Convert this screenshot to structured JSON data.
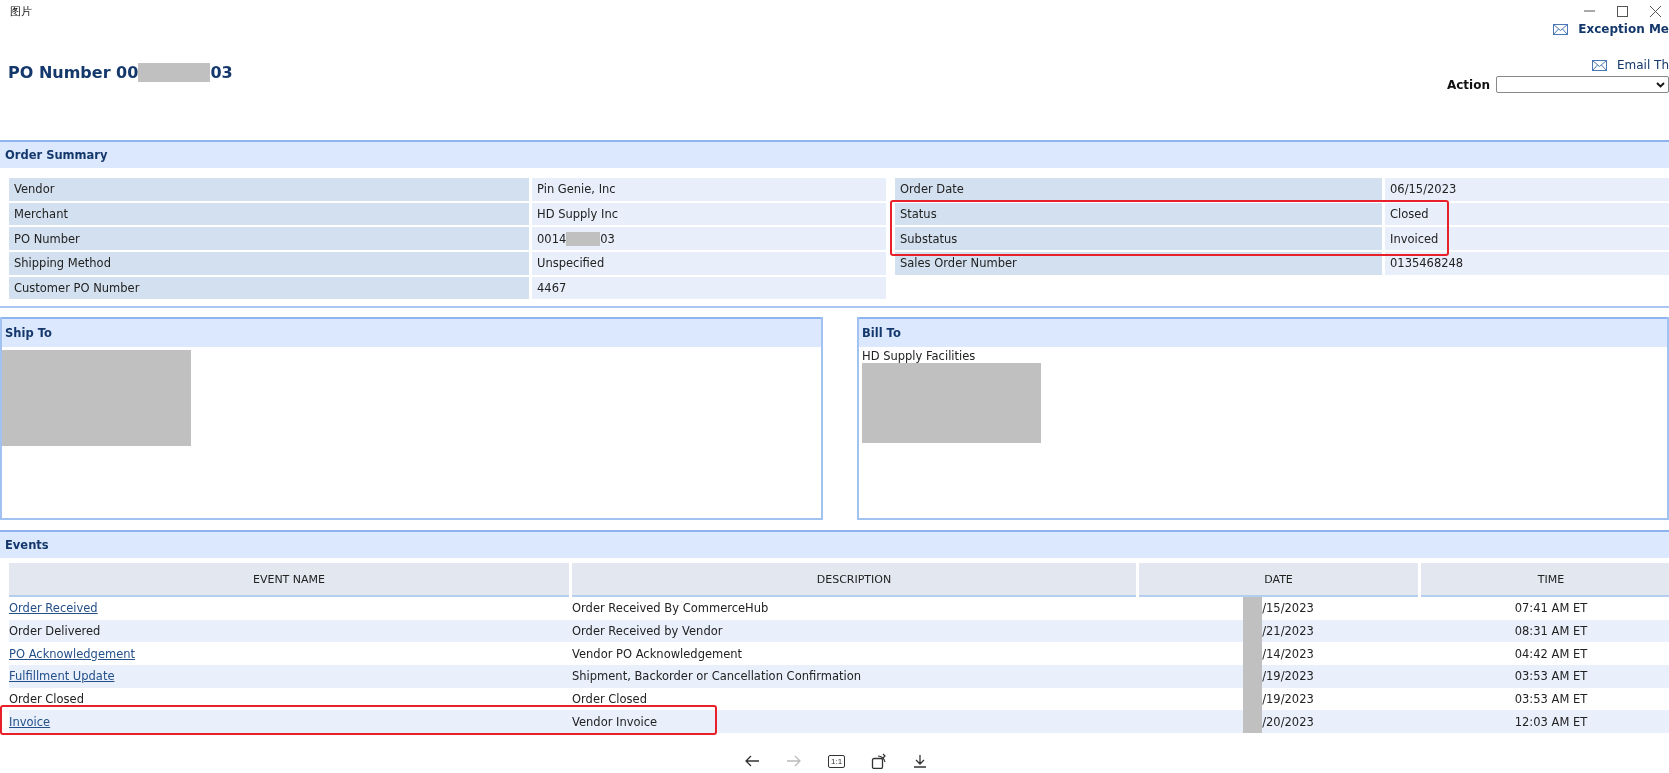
{
  "window": {
    "title": "图片"
  },
  "header": {
    "heading_prefix": "PO Number 00",
    "heading_suffix": "03",
    "links": [
      "Exception Me",
      "Email Th"
    ],
    "action_label": "Action"
  },
  "order_summary": {
    "title": "Order Summary",
    "left": [
      {
        "label": "Vendor",
        "value": "Pin Genie, Inc"
      },
      {
        "label": "Merchant",
        "value": "HD Supply Inc"
      },
      {
        "label": "PO Number",
        "value_prefix": "0014",
        "value_suffix": "03"
      },
      {
        "label": "Shipping Method",
        "value": "Unspecified"
      },
      {
        "label": "Customer PO Number",
        "value": "4467"
      }
    ],
    "right": [
      {
        "label": "Order Date",
        "value": "06/15/2023",
        "highlighted": false
      },
      {
        "label": "Status",
        "value": "Closed",
        "highlighted": true
      },
      {
        "label": "Substatus",
        "value": "Invoiced",
        "highlighted": true
      },
      {
        "label": "Sales Order Number",
        "value": "0135468248",
        "highlighted": false
      }
    ]
  },
  "ship_to": {
    "title": "Ship To"
  },
  "bill_to": {
    "title": "Bill To",
    "line": "HD Supply Facilities"
  },
  "events": {
    "title": "Events",
    "columns": [
      "EVENT NAME",
      "DESCRIPTION",
      "DATE",
      "TIME"
    ],
    "rows": [
      {
        "name": "Order Received",
        "link": true,
        "description": "Order Received By CommerceHub",
        "date": "/15/2023",
        "time": "07:41 AM ET",
        "highlighted": false
      },
      {
        "name": "Order Delivered",
        "link": false,
        "description": "Order Received by Vendor",
        "date": "/21/2023",
        "time": "08:31 AM ET",
        "highlighted": false
      },
      {
        "name": "PO Acknowledgement",
        "link": true,
        "description": "Vendor PO Acknowledgement",
        "date": "/14/2023",
        "time": "04:42 AM ET",
        "highlighted": false
      },
      {
        "name": "Fulfillment Update",
        "link": true,
        "description": "Shipment, Backorder or Cancellation Confirmation",
        "date": "/19/2023",
        "time": "03:53 AM ET",
        "highlighted": false
      },
      {
        "name": "Order Closed",
        "link": false,
        "description": "Order Closed",
        "date": "/19/2023",
        "time": "03:53 AM ET",
        "highlighted": false
      },
      {
        "name": "Invoice",
        "link": true,
        "description": "Vendor Invoice",
        "date": "/20/2023",
        "time": "12:03 AM ET",
        "highlighted": true
      }
    ]
  },
  "viewer_toolbar": {
    "actual_size_label": "1:1",
    "forward_disabled": true
  }
}
